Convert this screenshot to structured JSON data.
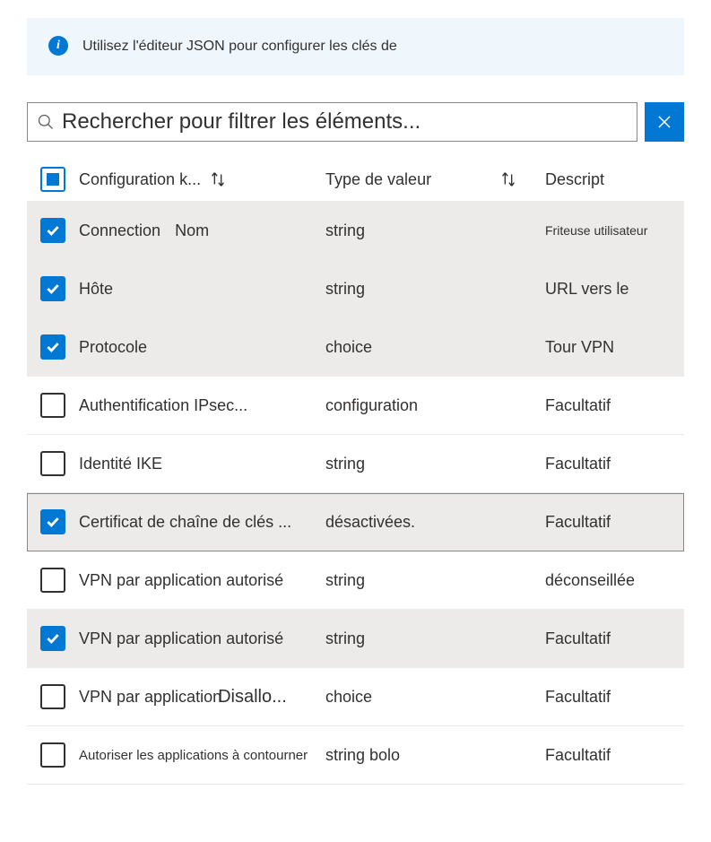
{
  "banner": {
    "text": "Utilisez l'éditeur JSON pour configurer les clés de"
  },
  "search": {
    "placeholder": "Rechercher pour filtrer les éléments..."
  },
  "columns": {
    "name": "Configuration k...",
    "type": "Type de valeur",
    "description": "Descript"
  },
  "rows": [
    {
      "checked": true,
      "name": "Connection",
      "extra": "Nom",
      "type": "string",
      "desc": "Friteuse utilisateur",
      "descSmall": true
    },
    {
      "checked": true,
      "name": "Hôte",
      "type": "string",
      "desc": "URL vers le"
    },
    {
      "checked": true,
      "name": "Protocole",
      "type": "choice",
      "desc": "Tour VPN"
    },
    {
      "checked": false,
      "name": "Authentification IPsec...",
      "type": "configuration",
      "desc": "Facultatif"
    },
    {
      "checked": false,
      "name": "Identité IKE",
      "type": "string",
      "desc": "Facultatif"
    },
    {
      "checked": true,
      "highlighted": true,
      "name": "Certificat de chaîne de clés ...",
      "type": "désactivées.",
      "desc": "Facultatif"
    },
    {
      "checked": false,
      "name": "VPN par application autorisé",
      "type": "string",
      "desc": "déconseillée"
    },
    {
      "checked": true,
      "name": "VPN par application autorisé",
      "type": "string",
      "desc": "Facultatif"
    },
    {
      "checked": false,
      "name": "VPN par application",
      "overlap": "Disallo...",
      "type": "choice",
      "desc": "Facultatif"
    },
    {
      "checked": false,
      "name": "Autoriser les applications à contourner",
      "nameSmall": true,
      "type": "string bolo",
      "desc": "Facultatif"
    }
  ]
}
